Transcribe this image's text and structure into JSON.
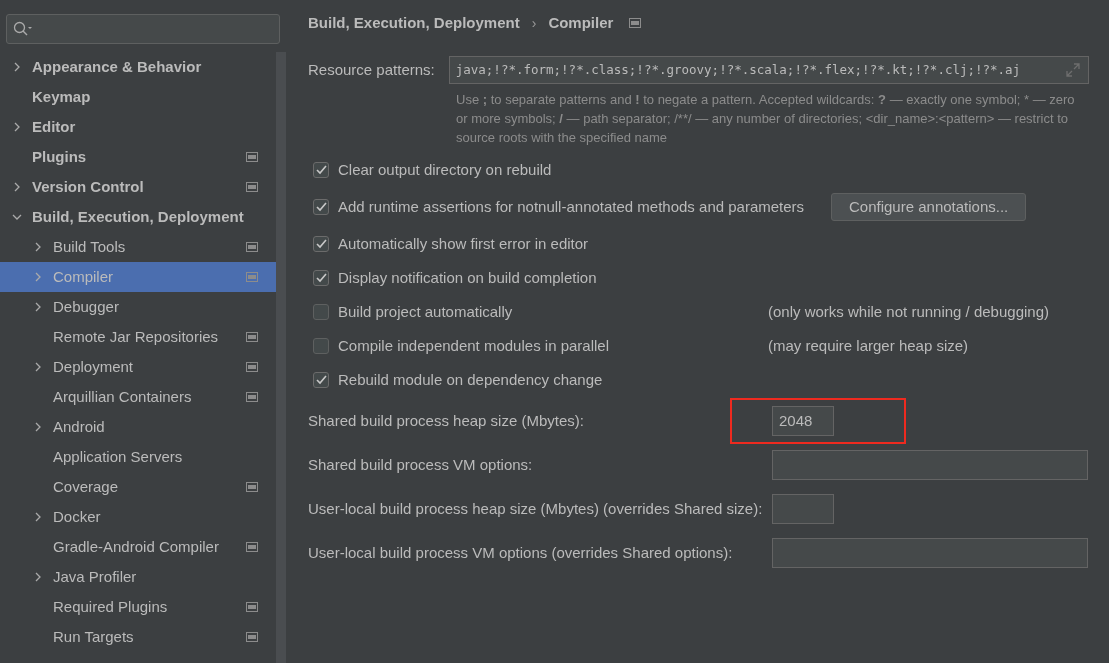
{
  "sidebar": {
    "items": [
      {
        "label": "Appearance & Behavior",
        "kind": "group",
        "expanded": false,
        "selected": false,
        "project_icon": false
      },
      {
        "label": "Keymap",
        "kind": "leaf",
        "selected": false,
        "project_icon": false
      },
      {
        "label": "Editor",
        "kind": "group",
        "expanded": false,
        "selected": false,
        "project_icon": false
      },
      {
        "label": "Plugins",
        "kind": "leaf",
        "selected": false,
        "project_icon": true
      },
      {
        "label": "Version Control",
        "kind": "group",
        "expanded": false,
        "selected": false,
        "project_icon": true
      },
      {
        "label": "Build, Execution, Deployment",
        "kind": "group",
        "expanded": true,
        "selected": false,
        "project_icon": false,
        "children": [
          {
            "label": "Build Tools",
            "kind": "group",
            "expanded": false,
            "selected": false,
            "project_icon": true
          },
          {
            "label": "Compiler",
            "kind": "group",
            "expanded": false,
            "selected": true,
            "project_icon": true
          },
          {
            "label": "Debugger",
            "kind": "group",
            "expanded": false,
            "selected": false,
            "project_icon": false
          },
          {
            "label": "Remote Jar Repositories",
            "kind": "leaf",
            "selected": false,
            "project_icon": true
          },
          {
            "label": "Deployment",
            "kind": "group",
            "expanded": false,
            "selected": false,
            "project_icon": true
          },
          {
            "label": "Arquillian Containers",
            "kind": "leaf",
            "selected": false,
            "project_icon": true
          },
          {
            "label": "Android",
            "kind": "group",
            "expanded": false,
            "selected": false,
            "project_icon": false
          },
          {
            "label": "Application Servers",
            "kind": "leaf",
            "selected": false,
            "project_icon": false
          },
          {
            "label": "Coverage",
            "kind": "leaf",
            "selected": false,
            "project_icon": true
          },
          {
            "label": "Docker",
            "kind": "group",
            "expanded": false,
            "selected": false,
            "project_icon": false
          },
          {
            "label": "Gradle-Android Compiler",
            "kind": "leaf",
            "selected": false,
            "project_icon": true
          },
          {
            "label": "Java Profiler",
            "kind": "group",
            "expanded": false,
            "selected": false,
            "project_icon": false
          },
          {
            "label": "Required Plugins",
            "kind": "leaf",
            "selected": false,
            "project_icon": true
          },
          {
            "label": "Run Targets",
            "kind": "leaf",
            "selected": false,
            "project_icon": true
          }
        ]
      }
    ]
  },
  "breadcrumb": {
    "items": [
      "Build, Execution, Deployment",
      "Compiler"
    ],
    "separator": "›"
  },
  "resource_patterns": {
    "label": "Resource patterns:",
    "value": "java;!?*.form;!?*.class;!?*.groovy;!?*.scala;!?*.flex;!?*.kt;!?*.clj;!?*.aj",
    "help": "Use **;** to separate patterns and **!** to negate a pattern. Accepted wildcards: **?** — exactly one symbol; * — zero or more symbols; **/** — path separator; /**/ — any number of directories; <dir_name>:<pattern> — restrict to source roots with the specified name"
  },
  "options": [
    {
      "label": "Clear output directory on rebuild",
      "checked": true
    },
    {
      "label": "Add runtime assertions for notnull-annotated methods and parameters",
      "checked": true,
      "button": "Configure annotations..."
    },
    {
      "label": "Automatically show first error in editor",
      "checked": true
    },
    {
      "label": "Display notification on build completion",
      "checked": true
    },
    {
      "label": "Build project automatically",
      "checked": false,
      "note": "(only works while not running / debugging)"
    },
    {
      "label": "Compile independent modules in parallel",
      "checked": false,
      "note": "(may require larger heap size)"
    },
    {
      "label": "Rebuild module on dependency change",
      "checked": true
    }
  ],
  "fields": [
    {
      "label": "Shared build process heap size (Mbytes):",
      "value": "2048",
      "kind": "short",
      "highlighted": true
    },
    {
      "label": "Shared build process VM options:",
      "kind": "wide",
      "highlighted": false
    },
    {
      "label": "User-local build process heap size (Mbytes) (overrides Shared size):",
      "kind": "short",
      "highlighted": false
    },
    {
      "label": "User-local build process VM options (overrides Shared options):",
      "kind": "wide",
      "highlighted": false
    }
  ]
}
